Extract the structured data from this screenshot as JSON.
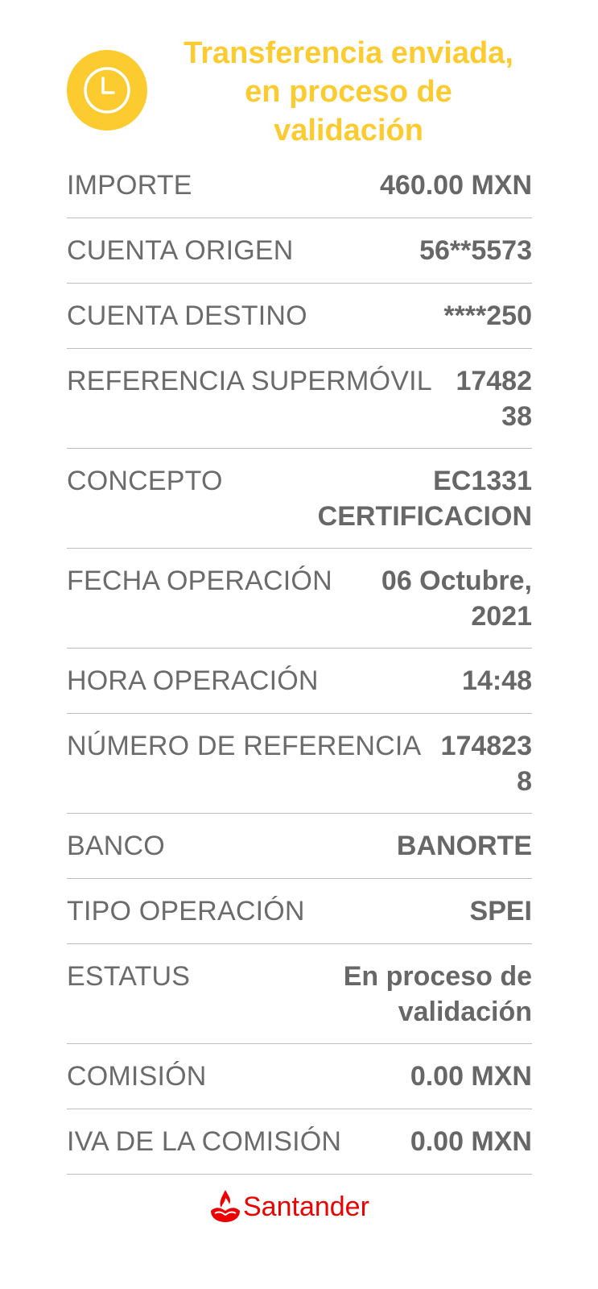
{
  "header": {
    "status_icon": "clock-icon",
    "title": "Transferencia enviada,\nen proceso de\nvalidación",
    "accent_color": "#fbcb2f"
  },
  "details": [
    {
      "label": "IMPORTE",
      "value": "460.00 MXN"
    },
    {
      "label": "CUENTA ORIGEN",
      "value": "56**5573"
    },
    {
      "label": "CUENTA DESTINO",
      "value": "****250"
    },
    {
      "label": "REFERENCIA SUPERMÓVIL",
      "value": "1748238"
    },
    {
      "label": "CONCEPTO",
      "value": "EC1331 CERTIFICACION"
    },
    {
      "label": "FECHA OPERACIÓN",
      "value": "06 Octubre, 2021"
    },
    {
      "label": "HORA OPERACIÓN",
      "value": "14:48"
    },
    {
      "label": "NÚMERO DE REFERENCIA",
      "value": "1748238"
    },
    {
      "label": "BANCO",
      "value": "BANORTE"
    },
    {
      "label": "TIPO OPERACIÓN",
      "value": "SPEI"
    },
    {
      "label": "ESTATUS",
      "value": "En proceso de validación"
    },
    {
      "label": "COMISIÓN",
      "value": "0.00 MXN"
    },
    {
      "label": "IVA DE LA COMISIÓN",
      "value": "0.00 MXN"
    }
  ],
  "footer": {
    "brand_name": "Santander",
    "brand_icon": "santander-flame-icon",
    "brand_color": "#ec0000"
  }
}
